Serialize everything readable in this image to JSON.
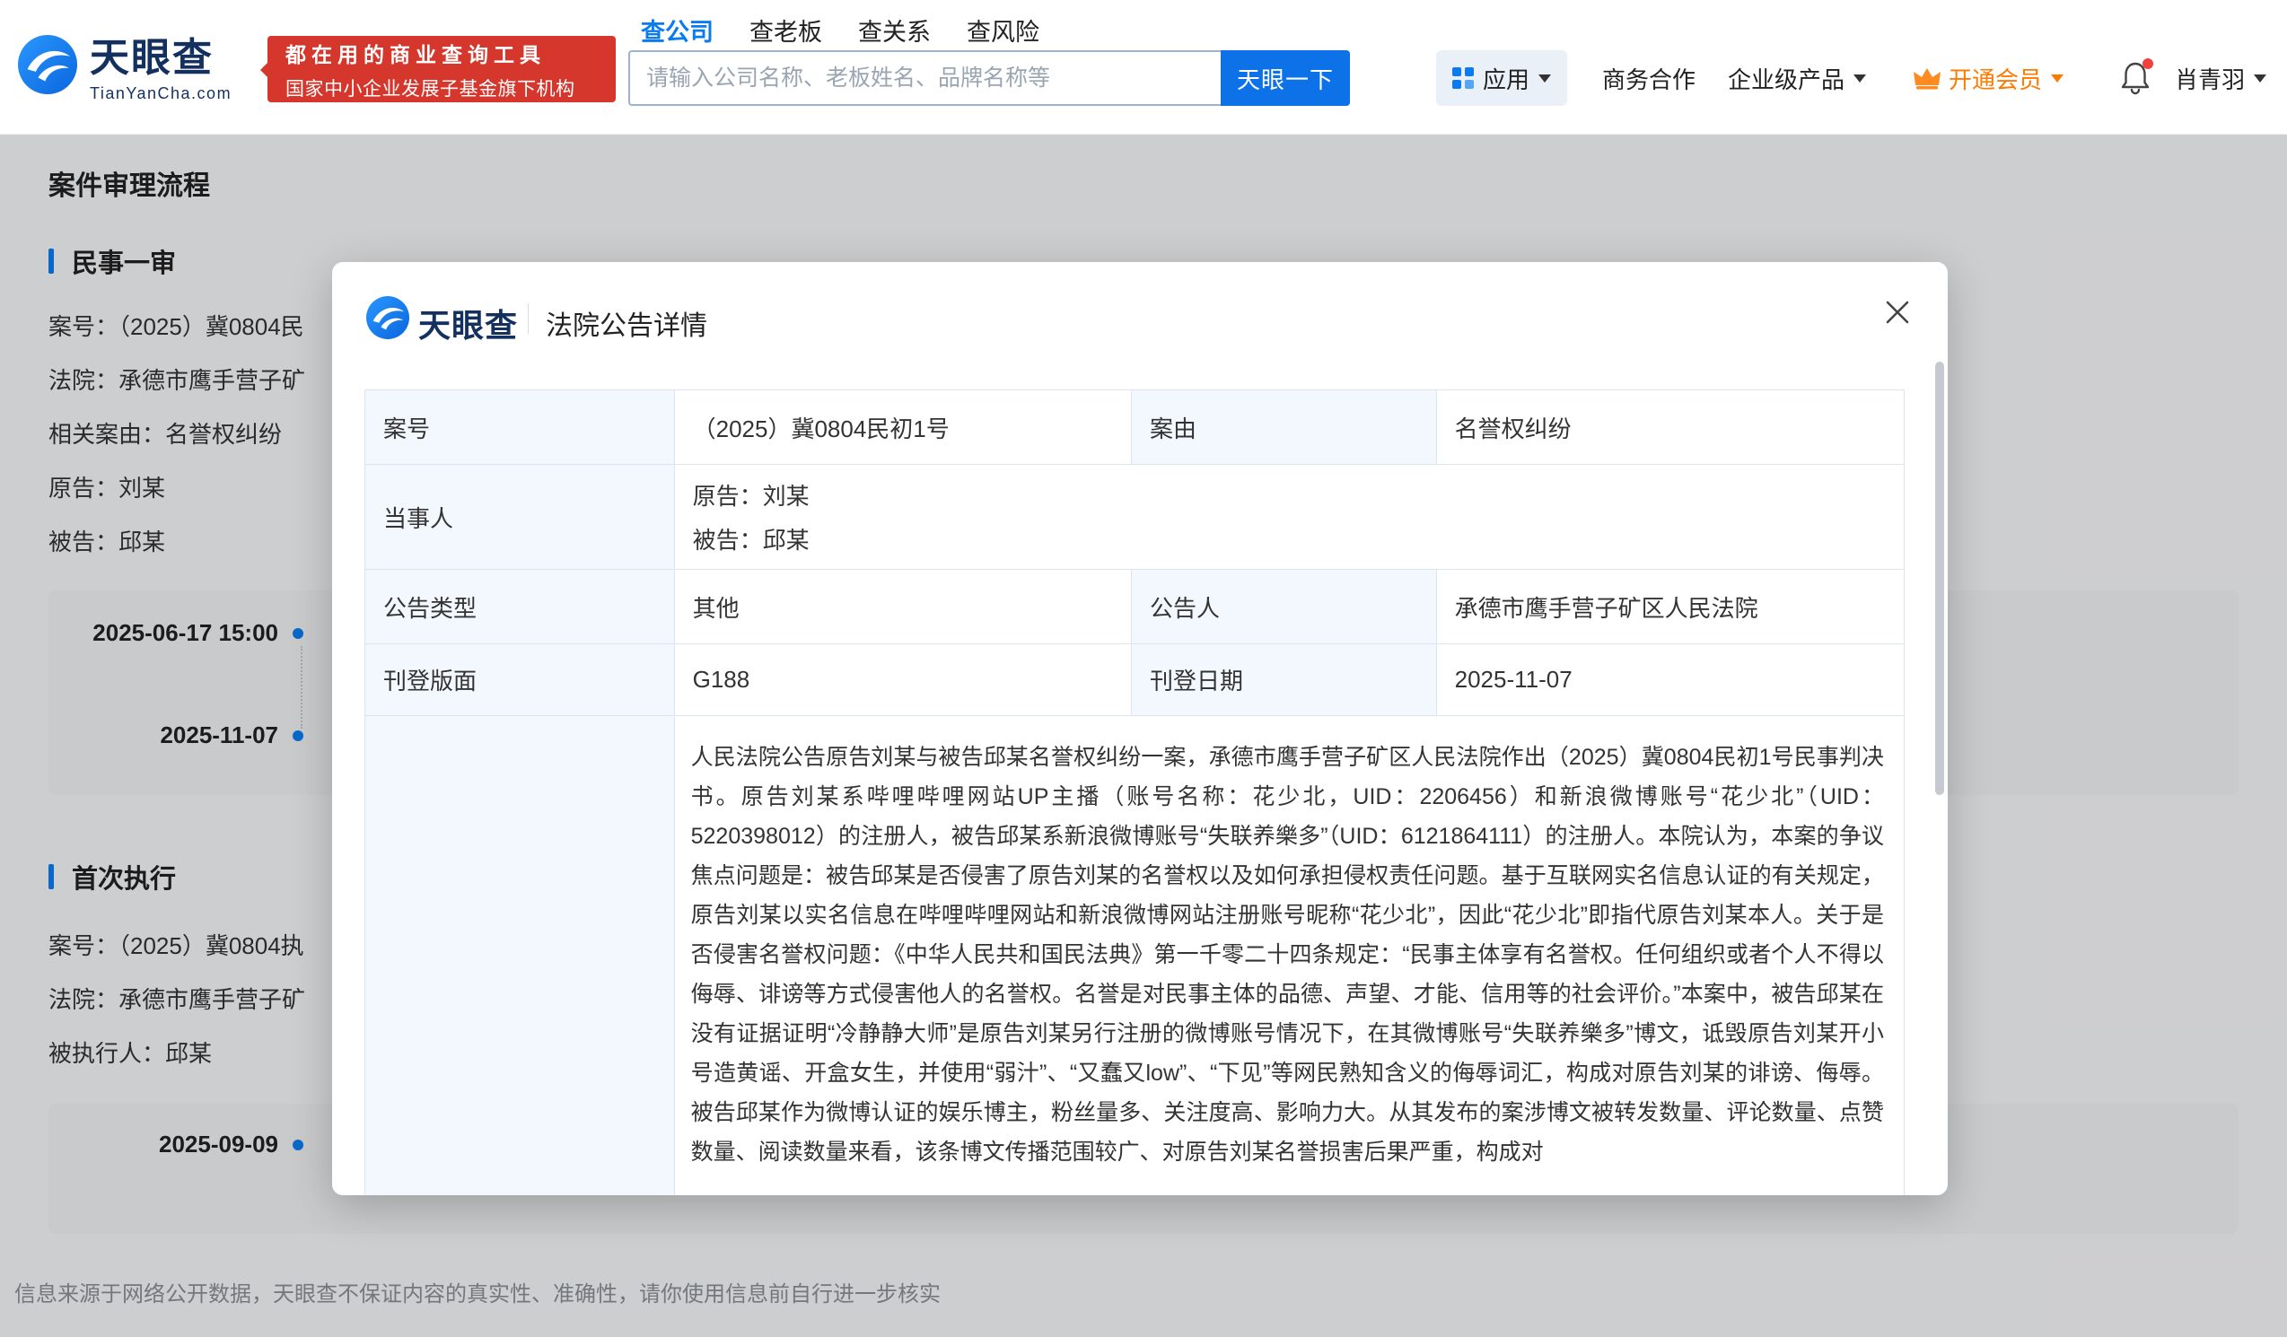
{
  "colors": {
    "brand_blue": "#0b7cf0",
    "button_blue": "#0d72e8",
    "promo_red": "#d5372d",
    "vip_orange": "#ff7a00",
    "table_label_bg": "#f2f8fd",
    "table_border": "#dce4ee"
  },
  "header": {
    "brand": {
      "name_cn": "天眼查",
      "domain": "TianYanCha.com"
    },
    "promo": {
      "line1": "都在用的商业查询工具",
      "line2": "国家中小企业发展子基金旗下机构"
    },
    "tabs": [
      {
        "label": "查公司"
      },
      {
        "label": "查老板"
      },
      {
        "label": "查关系"
      },
      {
        "label": "查风险"
      }
    ],
    "search": {
      "placeholder": "请输入公司名称、老板姓名、品牌名称等",
      "button": "天眼一下"
    },
    "nav": {
      "apps": "应用",
      "cooperation": "商务合作",
      "enterprise": "企业级产品",
      "vip": "开通会员",
      "username": "肖青羽"
    }
  },
  "page": {
    "title": "案件审理流程",
    "section1": {
      "title": "民事一审",
      "fields": [
        "案号：（2025）冀0804民",
        "法院：承德市鹰手营子矿",
        "相关案由：名誉权纠纷",
        "原告：刘某",
        "被告：邱某"
      ],
      "timeline": [
        "2025-06-17 15:00",
        "2025-11-07"
      ]
    },
    "section2": {
      "title": "首次执行",
      "fields": [
        "案号：（2025）冀0804执",
        "法院：承德市鹰手营子矿",
        "被执行人：邱某"
      ],
      "timeline": [
        "2025-09-09"
      ]
    },
    "disclaimer": "信息来源于网络公开数据，天眼查不保证内容的真实性、准确性，请你使用信息前自行进一步核实"
  },
  "modal": {
    "brand": "天眼查",
    "title": "法院公告详情",
    "table": {
      "r1": {
        "l1": "案号",
        "v1": "（2025）冀0804民初1号",
        "l2": "案由",
        "v2": "名誉权纠纷"
      },
      "r2": {
        "l1": "当事人",
        "v1a": "原告：刘某",
        "v1b": "被告：邱某"
      },
      "r3": {
        "l1": "公告类型",
        "v1": "其他",
        "l2": "公告人",
        "v2": "承德市鹰手营子矿区人民法院"
      },
      "r4": {
        "l1": "刊登版面",
        "v1": "G188",
        "l2": "刊登日期",
        "v2": "2025-11-07"
      },
      "content": "人民法院公告原告刘某与被告邱某名誉权纠纷一案，承德市鹰手营子矿区人民法院作出（2025）冀0804民初1号民事判决书。原告刘某系哔哩哔哩网站UP主播（账号名称：花少北，UID：2206456）和新浪微博账号“花少北”（UID：5220398012）的注册人，被告邱某系新浪微博账号“失联养樂多”（UID：6121864111）的注册人。本院认为，本案的争议焦点问题是：被告邱某是否侵害了原告刘某的名誉权以及如何承担侵权责任问题。基于互联网实名信息认证的有关规定，原告刘某以实名信息在哔哩哔哩网站和新浪微博网站注册账号昵称“花少北”，因此“花少北”即指代原告刘某本人。关于是否侵害名誉权问题：《中华人民共和国民法典》第一千零二十四条规定：“民事主体享有名誉权。任何组织或者个人不得以侮辱、诽谤等方式侵害他人的名誉权。名誉是对民事主体的品德、声望、才能、信用等的社会评价。”本案中，被告邱某在没有证据证明“冷静静大师”是原告刘某另行注册的微博账号情况下，在其微博账号“失联养樂多”博文，诋毁原告刘某开小号造黄谣、开盒女生，并使用“弱汁”、“又蠢又low”、“下见”等网民熟知含义的侮辱词汇，构成对原告刘某的诽谤、侮辱。被告邱某作为微博认证的娱乐博主，粉丝量多、关注度高、影响力大。从其发布的案涉博文被转发数量、评论数量、点赞数量、阅读数量来看，该条博文传播范围较广、对原告刘某名誉损害后果严重，构成对"
    }
  }
}
